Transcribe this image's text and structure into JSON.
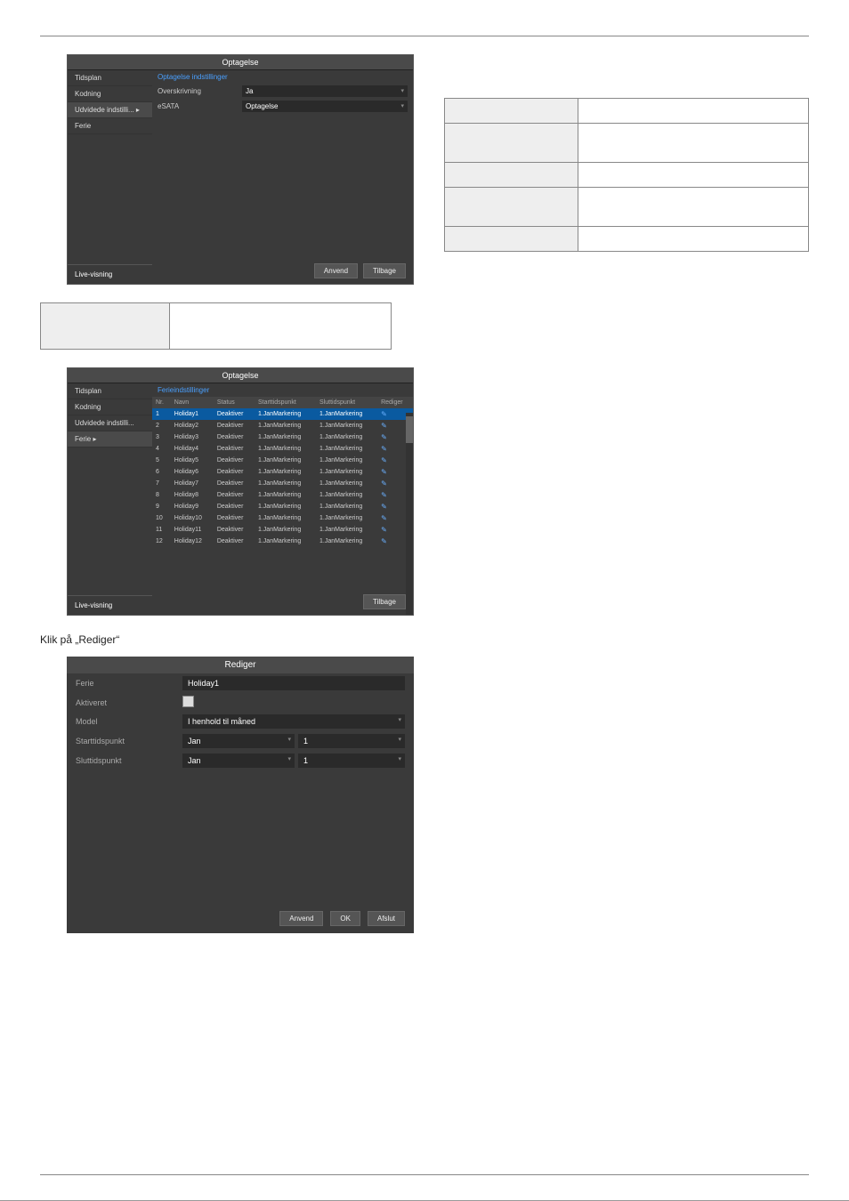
{
  "screenshot1": {
    "title": "Optagelse",
    "sidebar": {
      "items": [
        {
          "label": "Tidsplan"
        },
        {
          "label": "Kodning"
        },
        {
          "label": "Udvidede indstilli... ▸"
        },
        {
          "label": "Ferie"
        }
      ],
      "bottom": "Live-visning"
    },
    "tab": "Optagelse  indstillinger",
    "rows": [
      {
        "label": "Overskrivning",
        "value": "Ja"
      },
      {
        "label": "eSATA",
        "value": "Optagelse"
      }
    ],
    "buttons": {
      "apply": "Anvend",
      "back": "Tilbage"
    }
  },
  "desc_table": [
    {
      "left": "",
      "right": ""
    },
    {
      "left": "",
      "right": ""
    },
    {
      "left": "",
      "right": ""
    },
    {
      "left": "",
      "right": ""
    },
    {
      "left": "",
      "right": ""
    }
  ],
  "single_table": {
    "left": "",
    "right": ""
  },
  "screenshot2": {
    "title": "Optagelse",
    "sidebar": {
      "items": [
        {
          "label": "Tidsplan"
        },
        {
          "label": "Kodning"
        },
        {
          "label": "Udvidede indstilli..."
        },
        {
          "label": "Ferie  ▸"
        }
      ],
      "bottom": "Live-visning"
    },
    "tab": "Ferieindstillinger",
    "columns": {
      "nr": "Nr.",
      "name": "Navn",
      "status": "Status",
      "start": "Starttidspunkt",
      "end": "Sluttidspunkt",
      "edit": "Rediger"
    },
    "rows": [
      {
        "nr": "1",
        "name": "Holiday1",
        "status": "Deaktiver",
        "start": "1.JanMarkering",
        "end": "1.JanMarkering"
      },
      {
        "nr": "2",
        "name": "Holiday2",
        "status": "Deaktiver",
        "start": "1.JanMarkering",
        "end": "1.JanMarkering"
      },
      {
        "nr": "3",
        "name": "Holiday3",
        "status": "Deaktiver",
        "start": "1.JanMarkering",
        "end": "1.JanMarkering"
      },
      {
        "nr": "4",
        "name": "Holiday4",
        "status": "Deaktiver",
        "start": "1.JanMarkering",
        "end": "1.JanMarkering"
      },
      {
        "nr": "5",
        "name": "Holiday5",
        "status": "Deaktiver",
        "start": "1.JanMarkering",
        "end": "1.JanMarkering"
      },
      {
        "nr": "6",
        "name": "Holiday6",
        "status": "Deaktiver",
        "start": "1.JanMarkering",
        "end": "1.JanMarkering"
      },
      {
        "nr": "7",
        "name": "Holiday7",
        "status": "Deaktiver",
        "start": "1.JanMarkering",
        "end": "1.JanMarkering"
      },
      {
        "nr": "8",
        "name": "Holiday8",
        "status": "Deaktiver",
        "start": "1.JanMarkering",
        "end": "1.JanMarkering"
      },
      {
        "nr": "9",
        "name": "Holiday9",
        "status": "Deaktiver",
        "start": "1.JanMarkering",
        "end": "1.JanMarkering"
      },
      {
        "nr": "10",
        "name": "Holiday10",
        "status": "Deaktiver",
        "start": "1.JanMarkering",
        "end": "1.JanMarkering"
      },
      {
        "nr": "11",
        "name": "Holiday11",
        "status": "Deaktiver",
        "start": "1.JanMarkering",
        "end": "1.JanMarkering"
      },
      {
        "nr": "12",
        "name": "Holiday12",
        "status": "Deaktiver",
        "start": "1.JanMarkering",
        "end": "1.JanMarkering"
      }
    ],
    "buttons": {
      "back": "Tilbage"
    }
  },
  "click_text": "Klik på „Rediger“",
  "dialog": {
    "title": "Rediger",
    "rows": {
      "ferie_label": "Ferie",
      "ferie_value": "Holiday1",
      "aktiveret_label": "Aktiveret",
      "model_label": "Model",
      "model_value": "I henhold til måned",
      "start_label": "Starttidspunkt",
      "start_month": "Jan",
      "start_day": "1",
      "end_label": "Sluttidspunkt",
      "end_month": "Jan",
      "end_day": "1"
    },
    "buttons": {
      "apply": "Anvend",
      "ok": "OK",
      "close": "Afslut"
    }
  }
}
